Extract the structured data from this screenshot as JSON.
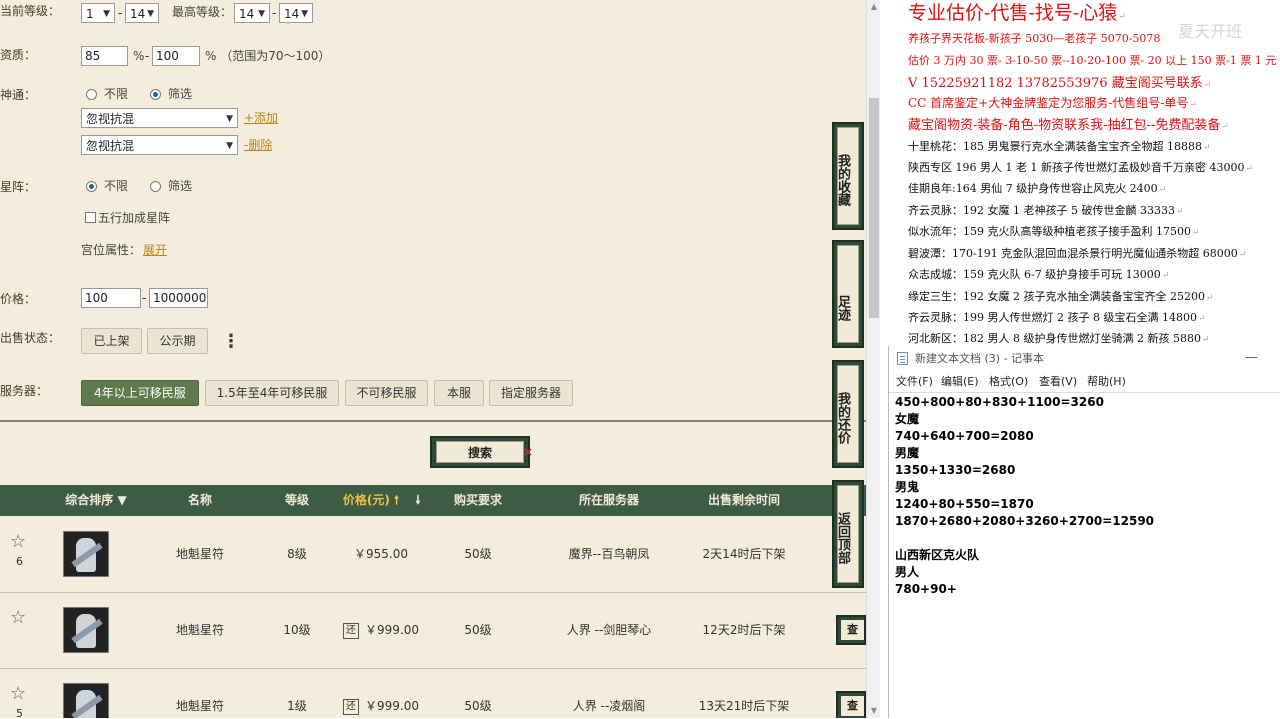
{
  "filters": {
    "current_level_label": "当前等级：",
    "current_level_from": "1",
    "current_level_to": "14",
    "max_level_label": "最高等级：",
    "max_level_from": "14",
    "max_level_to": "14",
    "aptitude_label": "资质：",
    "aptitude_min": "85",
    "aptitude_pct1": "%",
    "aptitude_max": "100",
    "aptitude_hint": "% （范围为70～100）",
    "shentong_label": "神通：",
    "shentong_opt_any": "不限",
    "shentong_opt_filter": "筛选",
    "shentong_select_1": "忽视抗混",
    "shentong_add": "+添加",
    "shentong_select_2": "忽视抗混",
    "shentong_delete": "-删除",
    "xingzhen_label": "星阵：",
    "xingzhen_opt_any": "不限",
    "xingzhen_opt_filter": "筛选",
    "wuxing_label": "五行加成星阵",
    "gongwei_label": "宫位属性：",
    "gongwei_expand": "展开",
    "price_label": "价格：",
    "price_min": "100",
    "price_max": "1000000",
    "sale_status_label": "出售状态：",
    "status_listed": "已上架",
    "status_public": "公示期",
    "server_label": "服务器：",
    "server_options": [
      "4年以上可移民服",
      "1.5年至4年可移民服",
      "不可移民服",
      "本服",
      "指定服务器"
    ],
    "dash": "-",
    "search_button": "搜索"
  },
  "table": {
    "headers": {
      "sort": "综合排序 ▼",
      "name": "名称",
      "level": "等级",
      "price": "价格(元) 🠕",
      "price_down": "🠗",
      "requirement": "购买要求",
      "server": "所在服务器",
      "time_left": "出售剩余时间"
    },
    "rows": [
      {
        "rank": "6",
        "name": "地魁星符",
        "level": "8级",
        "huan": "",
        "price": "￥955.00",
        "req": "50级",
        "server": "魔界--百鸟朝凤",
        "time": "2天14时后下架",
        "view": ""
      },
      {
        "rank": "",
        "name": "地魁星符",
        "level": "10级",
        "huan": "还",
        "price": "￥999.00",
        "req": "50级",
        "server": "人界 --剑胆琴心",
        "time": "12天2时后下架",
        "view": "查"
      },
      {
        "rank": "5",
        "name": "地魁星符",
        "level": "1级",
        "huan": "还",
        "price": "￥999.00",
        "req": "50级",
        "server": "人界 --凌烟阁",
        "time": "13天21时后下架",
        "view": "查"
      }
    ]
  },
  "side_nav": {
    "favorites": "我的收藏",
    "footprint": "足迹",
    "my_offers": "我的还价",
    "back_top": "返回顶部"
  },
  "info_panel": {
    "watermark": "夏天开班",
    "lines_red": [
      "专业估价-代售-找号-心猿",
      "养孩子界天花板-新孩子 5030—老孩子 5070-5078",
      "估价 3 万内 30 票- 3-10-50 票--10-20-100 票- 20 以上 150 票-1 票 1 元",
      "V 15225921182    13782553976    藏宝阁买号联系",
      "CC 首席鉴定+大神金牌鉴定为您服务-代售组号-单号",
      "藏宝阁物资-装备-角色-物资联系我-抽红包--免费配装备"
    ],
    "lines_black": [
      "十里桃花：185 男鬼景行克水全满装备宝宝齐全物超 18888",
      "陕西专区 196 男人 1 老 1 新孩子传世燃灯孟极妙音千万亲密 43000",
      "佳期良年:164 男仙 7 级护身传世容止风克火 2400",
      "齐云灵脉：192 女魔 1 老神孩子 5 破传世金麟 33333",
      "似水流年：159 克火队高等级种植老孩子接手盈利 17500",
      "碧波潭：170-191 克金队混回血混杀景行明光魔仙通杀物超 68000",
      "众志成城：159 克火队 6-7 级护身接手可玩 13000",
      "缘定三生：192 女魔 2 孩子克水抽全满装备宝宝齐全 25200",
      "齐云灵脉：199 男人传世燃灯 2 孩子 8 级宝石全满 14800",
      "河北新区：182 男人 8 级护身传世燃灯坐骑满 2 新孩 5880"
    ],
    "pilcrow": "↵"
  },
  "notepad": {
    "title": "新建文本文档 (3) - 记事本",
    "minimize": "—",
    "menu": [
      "文件(F)",
      "编辑(E)",
      "格式(O)",
      "查看(V)",
      "帮助(H)"
    ],
    "lines": [
      "450+800+80+830+1100=3260",
      "女魔",
      "740+640+700=2080",
      "男魔",
      "1350+1330=2680",
      "男鬼",
      "1240+80+550=1870",
      "1870+2680+2080+3260+2700=12590",
      "",
      "山西新区克火队",
      "男人",
      "780+90+"
    ]
  }
}
